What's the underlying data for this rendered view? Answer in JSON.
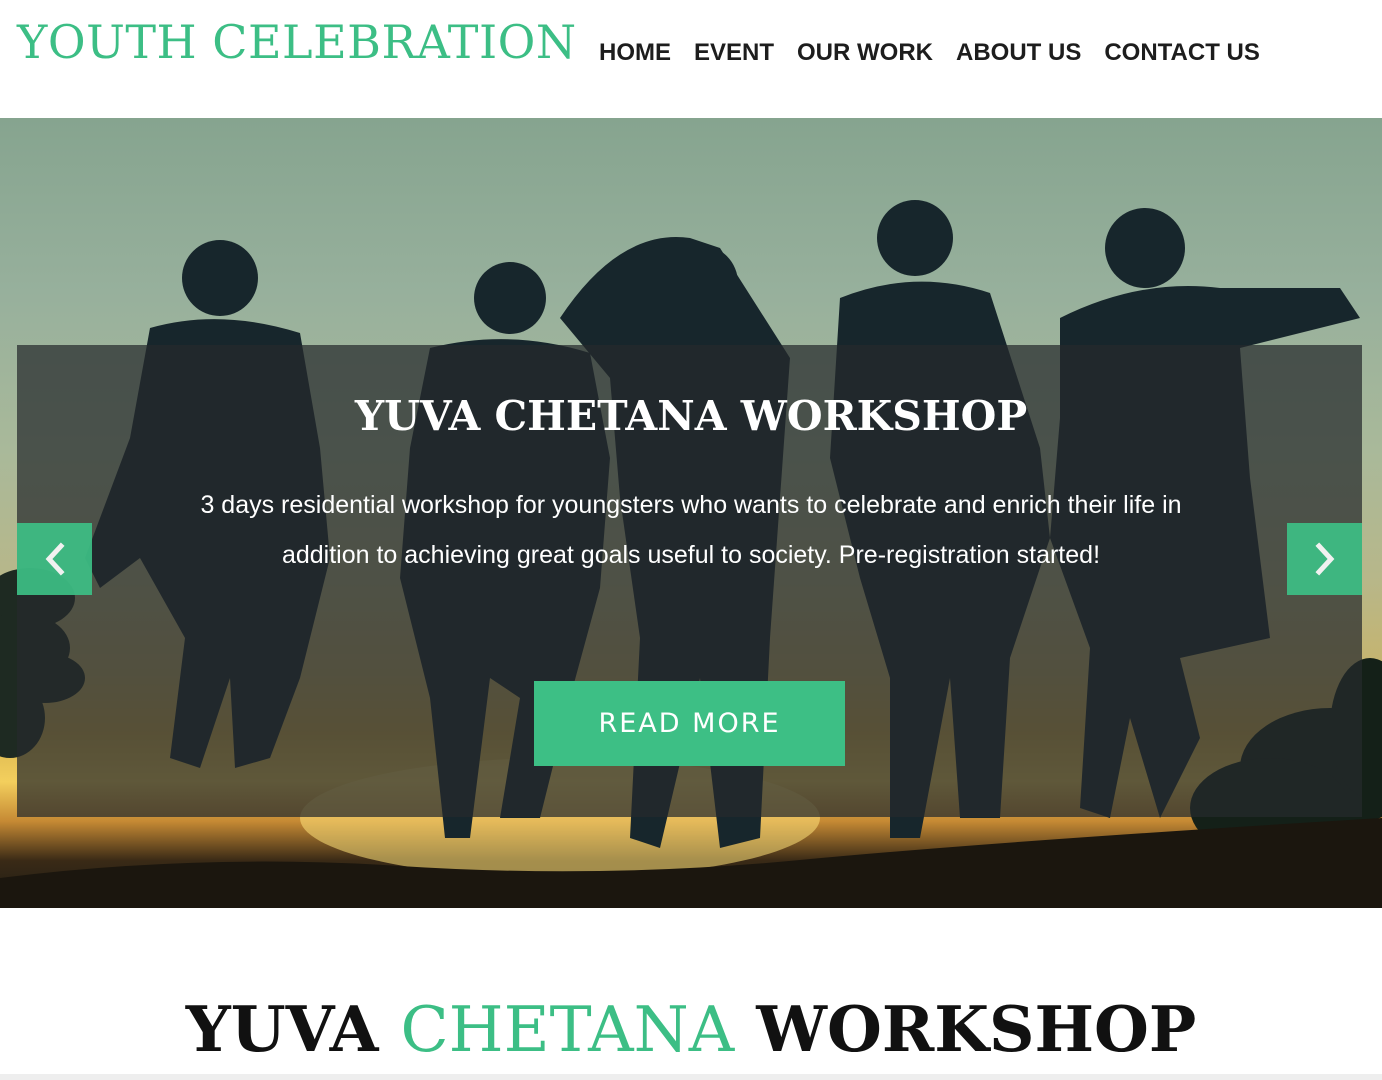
{
  "site": {
    "logo": "YOUTH CELEBRATION"
  },
  "nav": {
    "items": [
      {
        "label": "HOME"
      },
      {
        "label": "EVENT"
      },
      {
        "label": "OUR WORK"
      },
      {
        "label": "ABOUT US"
      },
      {
        "label": "CONTACT US"
      }
    ]
  },
  "slider": {
    "title": "YUVA CHETANA WORKSHOP",
    "text": "3 days residential workshop for youngsters who wants to celebrate and enrich their life in addition to achieving great goals useful to society. Pre-registration started!",
    "button_label": "READ MORE",
    "prev_icon": "chevron-left-icon",
    "next_icon": "chevron-right-icon"
  },
  "section": {
    "title_part1": "YUVA",
    "title_part2": "CHETANA",
    "title_part3": "WORKSHOP"
  },
  "colors": {
    "accent": "#3cbe85",
    "nav_text": "#1d1d1d",
    "overlay": "#262a2d"
  }
}
